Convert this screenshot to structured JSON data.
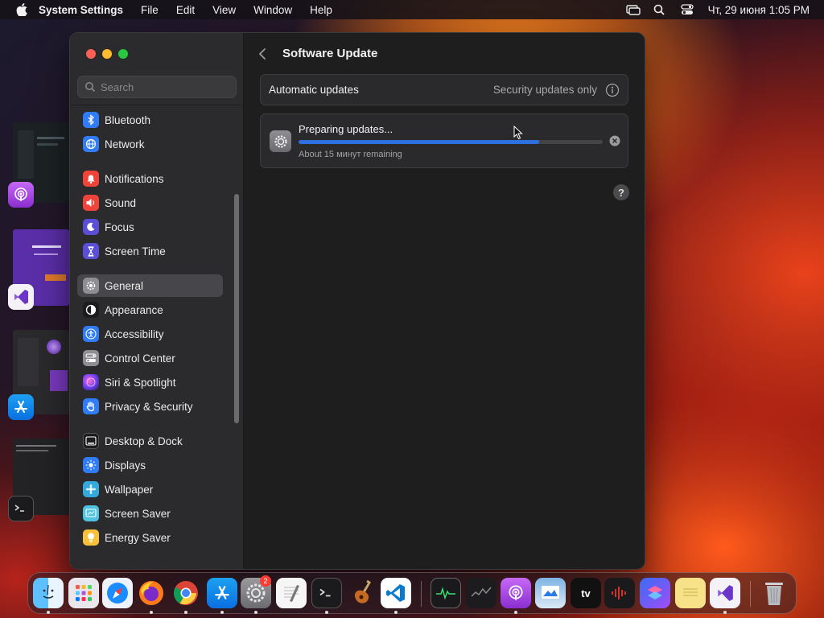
{
  "menubar": {
    "app_name": "System Settings",
    "menus": [
      "File",
      "Edit",
      "View",
      "Window",
      "Help"
    ],
    "clock": "Чт, 29 июня  1:05 PM"
  },
  "search": {
    "placeholder": "Search"
  },
  "sidebar": {
    "items": [
      {
        "label": "Bluetooth",
        "icon": "bluetooth-icon",
        "color": "#2f7cf6"
      },
      {
        "label": "Network",
        "icon": "globe-icon",
        "color": "#2f7cf6"
      },
      {
        "label": "Notifications",
        "icon": "bell-icon",
        "color": "#f0443a"
      },
      {
        "label": "Sound",
        "icon": "speaker-icon",
        "color": "#f0443a"
      },
      {
        "label": "Focus",
        "icon": "moon-icon",
        "color": "#5b4fd8"
      },
      {
        "label": "Screen Time",
        "icon": "hourglass-icon",
        "color": "#5b4fd8"
      },
      {
        "label": "General",
        "icon": "gear-icon",
        "color": "#8e8e93",
        "selected": true
      },
      {
        "label": "Appearance",
        "icon": "appearance-icon",
        "color": "#1c1c1e"
      },
      {
        "label": "Accessibility",
        "icon": "accessibility-icon",
        "color": "#2f7cf6"
      },
      {
        "label": "Control Center",
        "icon": "toggles-icon",
        "color": "#8e8e93"
      },
      {
        "label": "Siri & Spotlight",
        "icon": "siri-icon",
        "color": "#c240c6"
      },
      {
        "label": "Privacy & Security",
        "icon": "hand-icon",
        "color": "#2f7cf6"
      },
      {
        "label": "Desktop & Dock",
        "icon": "dock-icon",
        "color": "#1c1c1e"
      },
      {
        "label": "Displays",
        "icon": "sun-icon",
        "color": "#2f7cf6"
      },
      {
        "label": "Wallpaper",
        "icon": "wallpaper-icon",
        "color": "#34aadc"
      },
      {
        "label": "Screen Saver",
        "icon": "screensaver-icon",
        "color": "#4fc3e0"
      },
      {
        "label": "Energy Saver",
        "icon": "bulb-icon",
        "color": "#f7c23a"
      }
    ]
  },
  "content": {
    "title": "Software Update",
    "automatic_updates": {
      "label": "Automatic updates",
      "value": "Security updates only"
    },
    "progress": {
      "title": "Preparing updates...",
      "subtitle": "About 15 минут remaining",
      "fraction": 0.79
    },
    "help": "?"
  },
  "dock": {
    "apps": [
      "finder-icon",
      "launchpad-icon",
      "safari-icon",
      "firefox-icon",
      "chrome-icon",
      "app-store-icon",
      "system-settings-icon",
      "textedit-icon",
      "terminal-icon",
      "garageband-icon",
      "vscode-icon",
      "activity-monitor-icon",
      "stocks-icon",
      "podcasts-icon",
      "preview-icon",
      "apple-tv-icon",
      "voice-memos-icon",
      "shortcuts-icon",
      "stickies-icon",
      "visual-studio-icon",
      "trash-icon"
    ],
    "settings_badge": "2",
    "tv_label": "tv"
  },
  "colors": {
    "accent": "#2e6fe0",
    "window_bg": "#1e1e1f",
    "sidebar_bg": "#2b2a2c"
  }
}
